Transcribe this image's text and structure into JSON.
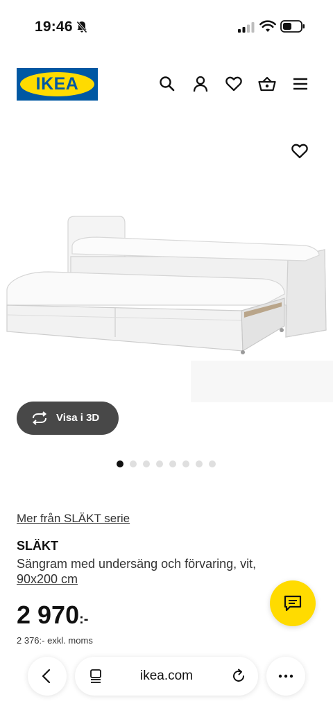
{
  "status_bar": {
    "time": "19:46"
  },
  "header": {
    "logo_text": "IKEA",
    "icons": [
      "search-icon",
      "account-icon",
      "heart-icon",
      "basket-icon",
      "menu-icon"
    ]
  },
  "gallery": {
    "view_3d_label": "Visa i 3D",
    "image_count": 8,
    "active_index": 0
  },
  "product": {
    "series_link": "Mer från SLÄKT serie",
    "name": "SLÄKT",
    "description": "Sängram med undersäng och förvaring, vit,",
    "size": "90x200 cm",
    "price_main": "2 970",
    "price_suffix": ":-",
    "price_ex_vat": "2 376:- exkl. moms"
  },
  "browser": {
    "url": "ikea.com"
  },
  "colors": {
    "ikea_blue": "#0058a3",
    "ikea_yellow": "#ffdb00",
    "pill_dark": "#484848"
  }
}
